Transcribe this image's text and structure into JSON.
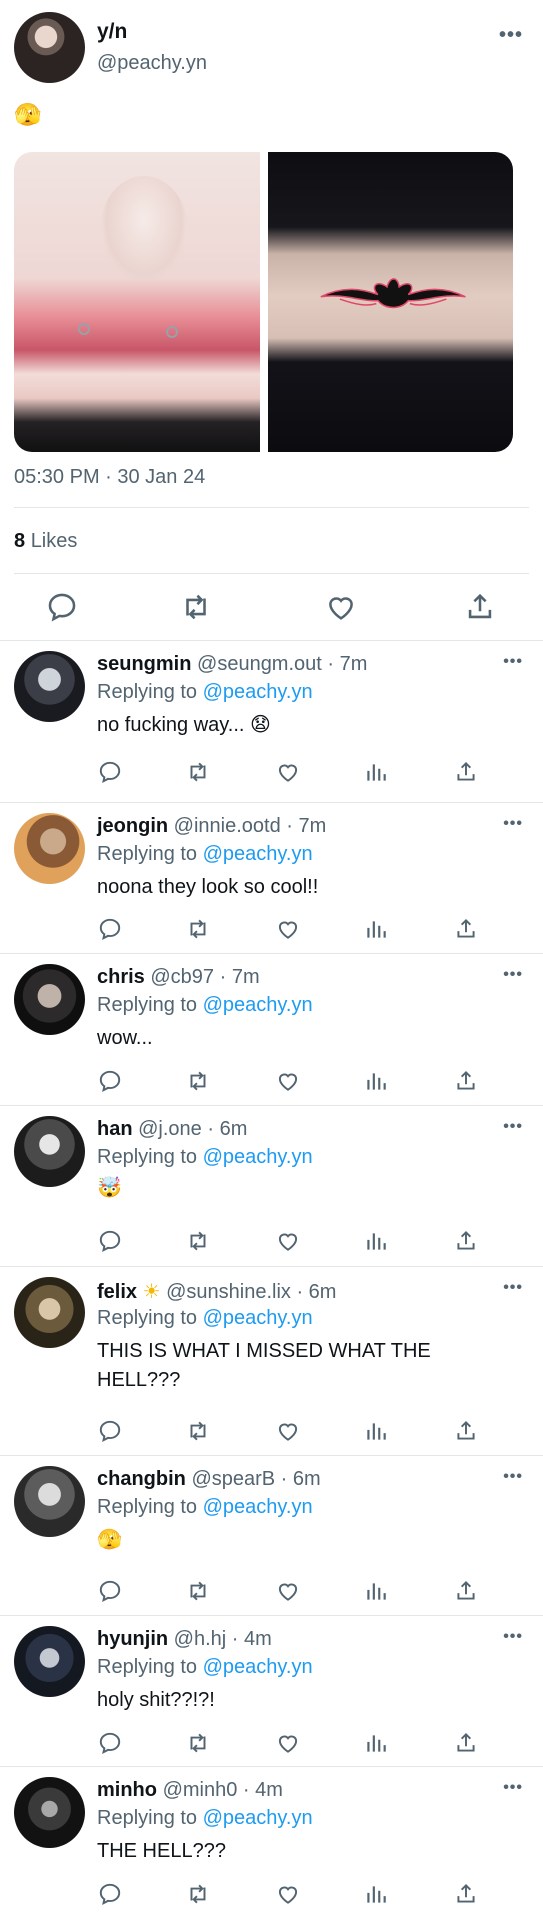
{
  "main_tweet": {
    "name": "y/n",
    "handle": "@peachy.yn",
    "more": "•••",
    "text_emoji": "🫣",
    "media": [
      "lip-piercing-photo",
      "lower-back-tattoo-photo"
    ],
    "timestamp": "05:30 PM · 30 Jan 24",
    "likes_count": "8",
    "likes_label": "Likes",
    "actions": [
      "reply-icon",
      "retweet-icon",
      "like-icon",
      "share-icon"
    ]
  },
  "replying_label": "Replying to",
  "replying_mention": "@peachy.yn",
  "replies": [
    {
      "name": "seungmin",
      "handle": "@seungm.out · 7m",
      "text": "no fucking way... 😧"
    },
    {
      "name": "jeongin",
      "handle": "@innie.ootd · 7m",
      "text": "noona they look so cool!!"
    },
    {
      "name": "chris",
      "handle": "@cb97 · 7m",
      "text": "wow..."
    },
    {
      "name": "han",
      "handle": "@j.one · 6m",
      "text": "🤯"
    },
    {
      "name": "felix",
      "name_emoji": "☀",
      "handle": "@sunshine.lix · 6m",
      "text": "THIS IS WHAT I MISSED WHAT THE HELL???"
    },
    {
      "name": "changbin",
      "handle": "@spearB · 6m",
      "text": "🫣"
    },
    {
      "name": "hyunjin",
      "handle": "@h.hj · 4m",
      "text": "holy shit??!?!"
    },
    {
      "name": "minho",
      "handle": "@minh0 · 4m",
      "text": "THE HELL???"
    }
  ],
  "colors": {
    "link": "#1d9bf0",
    "muted": "#536471",
    "text": "#0f1419",
    "divider": "#e4e6e8"
  },
  "reply_actions": [
    "reply-icon",
    "retweet-icon",
    "like-icon",
    "views-icon",
    "share-icon"
  ]
}
